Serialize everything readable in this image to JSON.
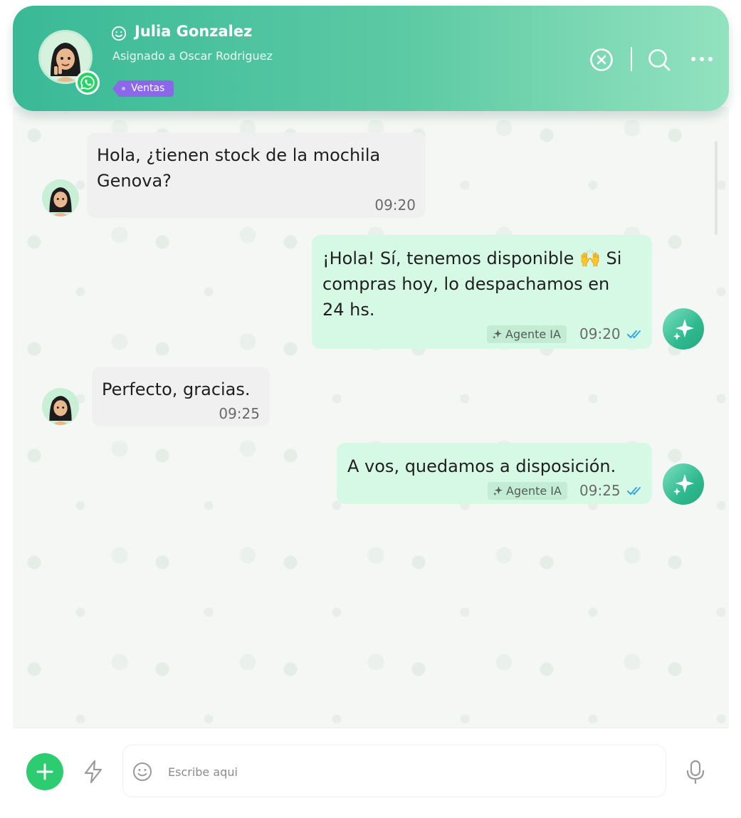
{
  "header": {
    "contact_name": "Julia Gonzalez",
    "assigned_to": "Asignado a Oscar Rodriguez",
    "tag": "Ventas",
    "channel_icon": "whatsapp-icon",
    "actions": [
      "close-icon",
      "search-icon",
      "more-icon"
    ]
  },
  "messages": [
    {
      "direction": "incoming",
      "text": "Hola, ¿tienen stock de la mochila\nGenova?",
      "time": "09:20"
    },
    {
      "direction": "outgoing",
      "text": "¡Hola! Sí, tenemos disponible 🙌 Si\ncompras hoy, lo despachamos en\n24 hs.",
      "agent": "Agente IA",
      "time": "09:20",
      "status": "read"
    },
    {
      "direction": "incoming",
      "text": "Perfecto, gracias.",
      "time": "09:25"
    },
    {
      "direction": "outgoing",
      "text": "A vos, quedamos a disposición.",
      "agent": "Agente IA",
      "time": "09:25",
      "status": "read"
    }
  ],
  "composer": {
    "placeholder": "Escribe aqui",
    "icons": [
      "add-icon",
      "bolt-icon",
      "emoji-icon",
      "microphone-icon"
    ]
  },
  "colors": {
    "header_gradient_start": "#3ab997",
    "header_gradient_end": "#93e2bf",
    "outgoing_bubble": "#d6f9e6",
    "incoming_bubble": "#f0f0f0",
    "tag": "#8b68e8",
    "read_check": "#35a8e0",
    "add_button": "#2ecc71"
  }
}
